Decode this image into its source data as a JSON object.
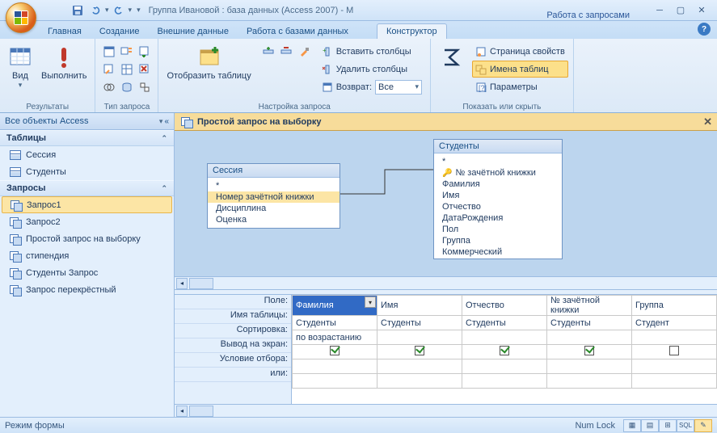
{
  "title": "Группа Ивановой : база данных (Access 2007) - M",
  "context_tab_group": "Работа с запросами",
  "tabs": [
    "Главная",
    "Создание",
    "Внешние данные",
    "Работа с базами данных"
  ],
  "context_tab": "Конструктор",
  "ribbon": {
    "groups": {
      "results": {
        "label": "Результаты",
        "view": "Вид",
        "run": "Выполнить"
      },
      "querytype": {
        "label": "Тип запроса"
      },
      "setup": {
        "label": "Настройка запроса",
        "show_table": "Отобразить таблицу",
        "insert_cols": "Вставить столбцы",
        "delete_cols": "Удалить столбцы",
        "return": "Возврат:",
        "return_val": "Все"
      },
      "totals_lbl": "Итоги",
      "showhide": {
        "label": "Показать или скрыть",
        "propsheet": "Страница свойств",
        "tablenames": "Имена таблиц",
        "params": "Параметры"
      }
    }
  },
  "nav": {
    "header": "Все объекты Access",
    "cats": {
      "tables": {
        "label": "Таблицы",
        "items": [
          "Сессия",
          "Студенты"
        ]
      },
      "queries": {
        "label": "Запросы",
        "items": [
          "Запрос1",
          "Запрос2",
          "Простой запрос на выборку",
          "стипендия",
          "Студенты Запрос",
          "Запрос перекрёстный"
        ],
        "selected": 0
      }
    }
  },
  "doc": {
    "tab": "Простой запрос на выборку",
    "lists": {
      "0": {
        "title": "Сессия",
        "fields": [
          "*",
          "Номер зачётной книжки",
          "Дисциплина",
          "Оценка"
        ]
      },
      "1": {
        "title": "Студенты",
        "fields": [
          "*",
          "№ зачётной книжки",
          "Фамилия",
          "Имя",
          "Отчество",
          "ДатаРождения",
          "Пол",
          "Группа",
          "Коммерческий"
        ],
        "key_idx": 1
      }
    },
    "grid": {
      "labels": [
        "Поле:",
        "Имя таблицы:",
        "Сортировка:",
        "Вывод на экран:",
        "Условие отбора:",
        "или:"
      ],
      "cols": [
        {
          "field": "Фамилия",
          "table": "Студенты",
          "sort": "по возрастанию",
          "show": true
        },
        {
          "field": "Имя",
          "table": "Студенты",
          "sort": "",
          "show": true
        },
        {
          "field": "Отчество",
          "table": "Студенты",
          "sort": "",
          "show": true
        },
        {
          "field": "№ зачётной книжки",
          "table": "Студенты",
          "sort": "",
          "show": true
        },
        {
          "field": "Группа",
          "table": "Студент",
          "sort": "",
          "show": false
        }
      ]
    }
  },
  "status": {
    "mode": "Режим формы",
    "numlock": "Num Lock"
  }
}
